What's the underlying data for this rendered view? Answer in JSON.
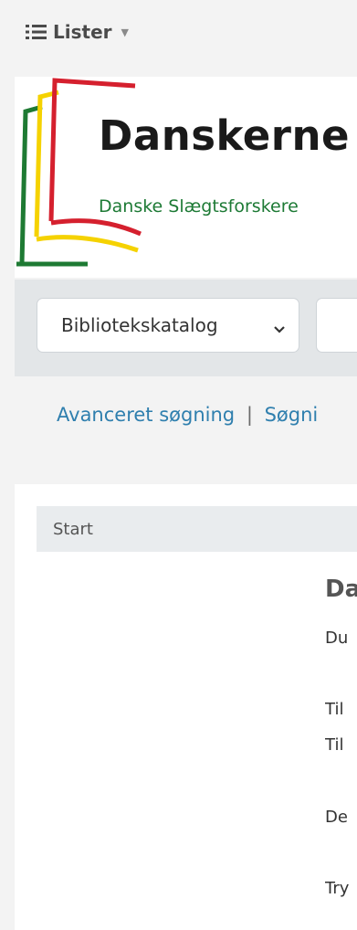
{
  "topbar": {
    "lists_label": "Lister",
    "lists_icon": "list-icon"
  },
  "header": {
    "brand_title": "Danskerne",
    "tagline": "Danske Slægtsforskere",
    "logo_colors": [
      "#d5202e",
      "#f5d200",
      "#1e7a33"
    ]
  },
  "search": {
    "catalog_select": "Bibliotekskatalog",
    "catalog_options": [
      "Bibliotekskatalog"
    ],
    "input_value": ""
  },
  "links": {
    "advanced_search": "Avanceret søgning",
    "separator": "|",
    "search_history": "Søgni"
  },
  "breadcrumb": {
    "start": "Start"
  },
  "main": {
    "title": "Da",
    "line1": "Du",
    "line2": "Til",
    "line3": "Til",
    "line4": "De",
    "line5": "Try"
  }
}
